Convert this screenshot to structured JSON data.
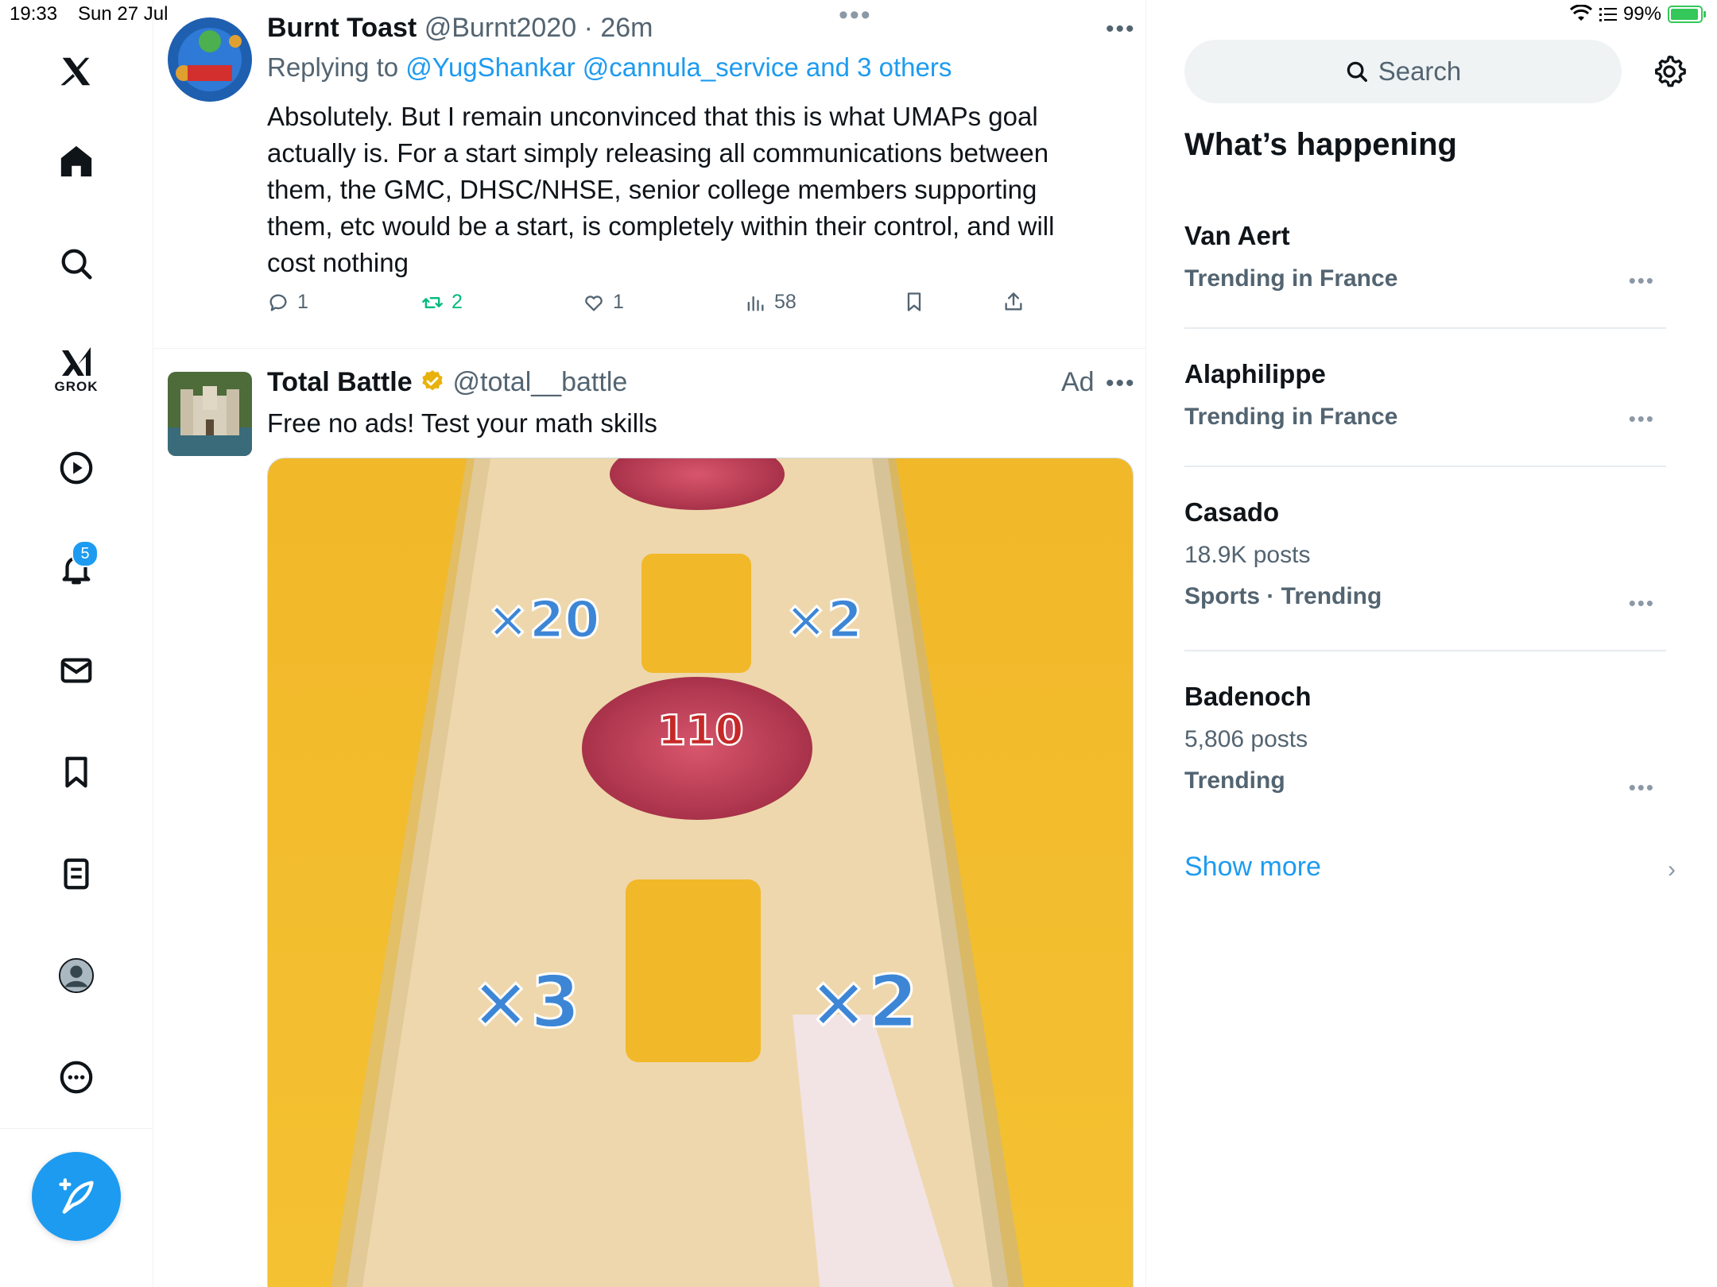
{
  "status_bar": {
    "time": "19:33",
    "date": "Sun 27 Jul",
    "battery": "99%"
  },
  "nav": {
    "notifications_badge": "5",
    "grok_label": "GROK"
  },
  "tweets": [
    {
      "name": "Burnt Toast",
      "handle": "@Burnt2020",
      "time": "· 26m",
      "replying_prefix": "Replying to ",
      "replying_to": "@YugShankar @cannula_service and 3 others",
      "text": "Absolutely. But I remain unconvinced that this is what UMAPs goal actually is. For a start simply releasing all communications between them, the GMC, DHSC/NHSE, senior college members supporting them, etc would be a start, is completely within their control, and will cost nothing",
      "replies": "1",
      "retweets": "2",
      "likes": "1",
      "views": "58"
    },
    {
      "name": "Total Battle",
      "handle": "@total__battle",
      "ad_label": "Ad",
      "text": "Free no ads! Test your math skills",
      "media_labels": [
        "×20",
        "×2",
        "110",
        "×3",
        "×2"
      ]
    }
  ],
  "sidebar": {
    "search_placeholder": "Search",
    "title": "What’s happening",
    "trends": [
      {
        "name": "Van Aert",
        "meta": "",
        "context": "Trending in France"
      },
      {
        "name": "Alaphilippe",
        "meta": "",
        "context": "Trending in France"
      },
      {
        "name": "Casado",
        "meta": "18.9K posts",
        "context": "Sports · Trending"
      },
      {
        "name": "Badenoch",
        "meta": "5,806 posts",
        "context": "Trending"
      }
    ],
    "show_more": "Show more"
  },
  "colors": {
    "accent": "#1d9bf0",
    "retweet": "#00ba7c",
    "secondary_text": "#536471"
  }
}
